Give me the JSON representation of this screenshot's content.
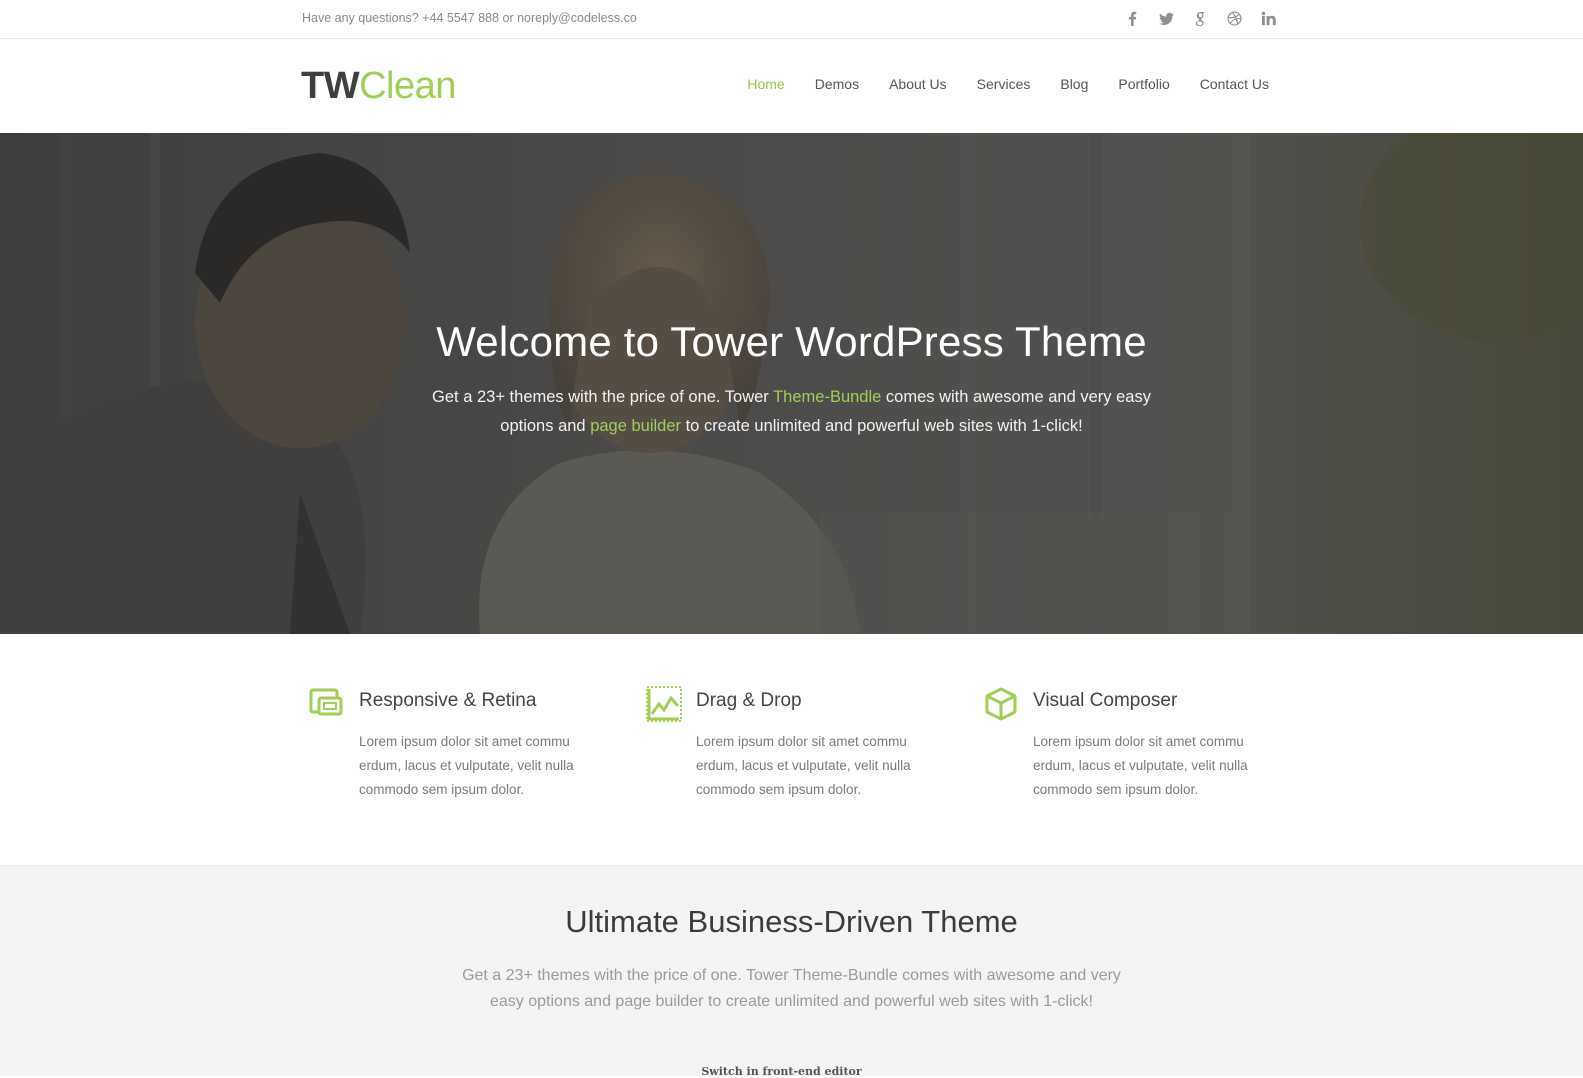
{
  "topbar": {
    "contact_text": "Have any questions? +44 5547 888 or noreply@codeless.co",
    "socials": [
      "facebook-icon",
      "twitter-icon",
      "google-plus-icon",
      "dribbble-icon",
      "linkedin-icon"
    ]
  },
  "header": {
    "logo_part1": "TW",
    "logo_part2": "Clean",
    "nav": [
      {
        "label": "Home",
        "active": true
      },
      {
        "label": "Demos",
        "active": false
      },
      {
        "label": "About Us",
        "active": false
      },
      {
        "label": "Services",
        "active": false
      },
      {
        "label": "Blog",
        "active": false
      },
      {
        "label": "Portfolio",
        "active": false
      },
      {
        "label": "Contact Us",
        "active": false
      }
    ]
  },
  "hero": {
    "title": "Welcome to Tower WordPress Theme",
    "sub_part1": "Get a 23+ themes with the price of one. Tower ",
    "sub_link1": "Theme-Bundle",
    "sub_part2": " comes with awesome and very easy options and ",
    "sub_link2": "page builder",
    "sub_part3": " to create unlimited and powerful web sites with 1-click!"
  },
  "features": [
    {
      "icon": "devices-icon",
      "title": "Responsive & Retina",
      "text": "Lorem ipsum dolor sit amet commu erdum, lacus et vulputate, velit nulla commodo sem ipsum dolor."
    },
    {
      "icon": "chart-icon",
      "title": "Drag & Drop",
      "text": "Lorem ipsum dolor sit amet commu erdum, lacus et vulputate, velit nulla commodo sem ipsum dolor."
    },
    {
      "icon": "cube-icon",
      "title": "Visual Composer",
      "text": "Lorem ipsum dolor sit amet commu erdum, lacus et vulputate, velit nulla commodo sem ipsum dolor."
    }
  ],
  "business": {
    "title": "Ultimate Business-Driven Theme",
    "subtitle": "Get a 23+ themes with the price of one. Tower Theme-Bundle comes with awesome and very easy options and page builder to create unlimited and powerful web sites with 1-click!",
    "editor_link": "Switch in front-end editor"
  },
  "colors": {
    "accent": "#a0cf56",
    "nav_active": "#94c64a",
    "logo_dark": "#3f3f3f",
    "section_bg": "#f4f4f4"
  }
}
